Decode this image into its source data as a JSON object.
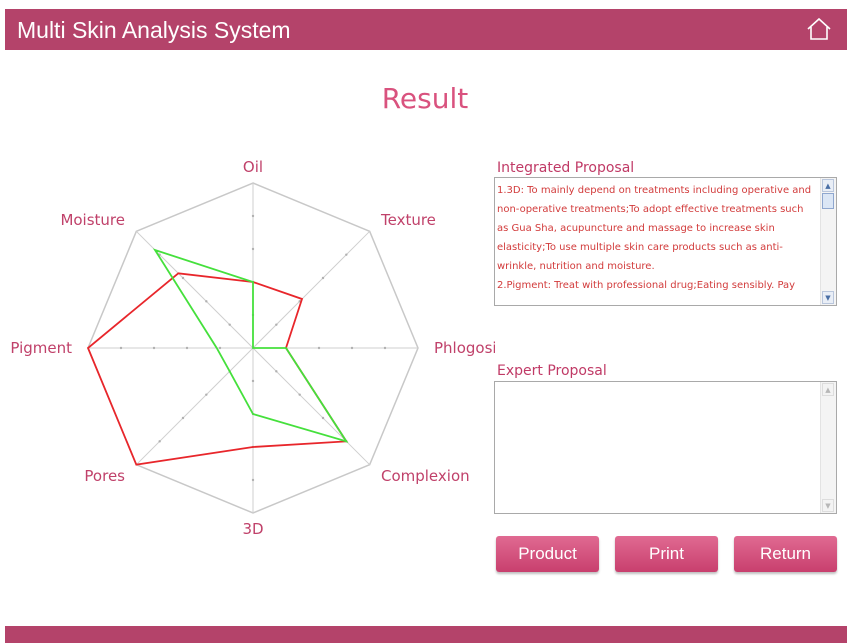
{
  "header": {
    "title": "Multi Skin Analysis System",
    "home_icon": "home-icon"
  },
  "page_title": "Result",
  "chart_data": {
    "type": "radar",
    "axes": [
      "Oil",
      "Texture",
      "Phlogosis",
      "Complexion",
      "3D",
      "Pores",
      "Pigment",
      "Moisture"
    ],
    "scale": [
      0,
      5
    ],
    "series": [
      {
        "color": "#e8262b",
        "values": [
          2,
          2.1,
          1,
          4,
          3,
          5,
          5,
          3.2
        ]
      },
      {
        "color": "#45e03c",
        "values": [
          2,
          0,
          1,
          4,
          2,
          1,
          1.1,
          4.2
        ]
      }
    ],
    "grid": true
  },
  "integrated_proposal": {
    "label": "Integrated Proposal",
    "lines": [
      "1.3D: To mainly depend on treatments including operative and",
      "non-operative treatments;To adopt effective treatments such",
      "as Gua Sha, acupuncture and massage to increase skin",
      "elasticity;To use multiple skin care products such as anti-",
      "wrinkle, nutrition and moisture.",
      "2.Pigment: Treat with professional drug;Eating sensibly. Pay"
    ]
  },
  "expert_proposal": {
    "label": "Expert Proposal",
    "value": ""
  },
  "buttons": {
    "product": "Product",
    "print": "Print",
    "return": "Return"
  },
  "colors": {
    "brand": "#b4436a",
    "accent": "#d9527e",
    "button": "#d4507e"
  }
}
